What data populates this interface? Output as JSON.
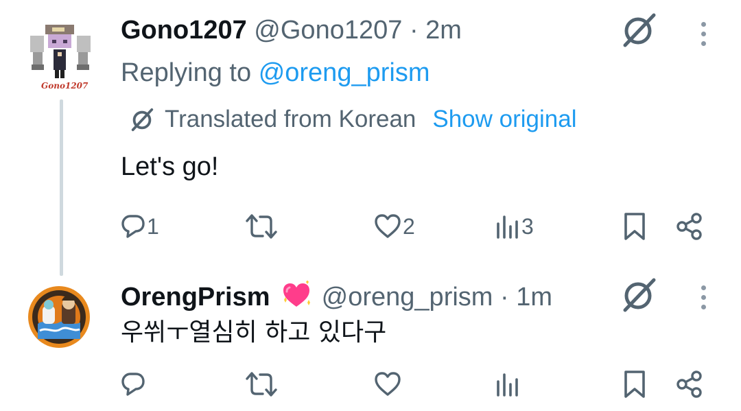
{
  "tweets": [
    {
      "display_name": "Gono1207",
      "handle": "@Gono1207",
      "separator": "·",
      "time": "2m",
      "avatar_caption": "Gono1207",
      "replying_prefix": "Replying to",
      "replying_to": "@oreng_prism",
      "translated_label": "Translated from Korean",
      "show_original": "Show original",
      "text": "Let's go!",
      "actions": {
        "reply_count": "1",
        "retweet_count": "",
        "like_count": "2",
        "views_count": "3"
      }
    },
    {
      "display_name": "OrengPrism",
      "name_emoji": "sparkling-heart",
      "handle": "@oreng_prism",
      "separator": "·",
      "time": "1m",
      "text": "우쒸ㅜ열심히 하고 있다구",
      "actions": {
        "reply_count": "",
        "retweet_count": "",
        "like_count": "",
        "views_count": ""
      }
    }
  ],
  "colors": {
    "text_primary": "#0f1419",
    "text_secondary": "#536471",
    "link": "#1d9bf0",
    "thread_line": "#cfd9de",
    "emoji_heart": "#ff3d8b"
  },
  "icons": {
    "translate": "translate-icon",
    "grok": "grok-icon",
    "more": "more-icon",
    "reply": "reply-icon",
    "retweet": "retweet-icon",
    "like": "heart-icon",
    "views": "views-icon",
    "bookmark": "bookmark-icon",
    "share": "share-icon"
  }
}
